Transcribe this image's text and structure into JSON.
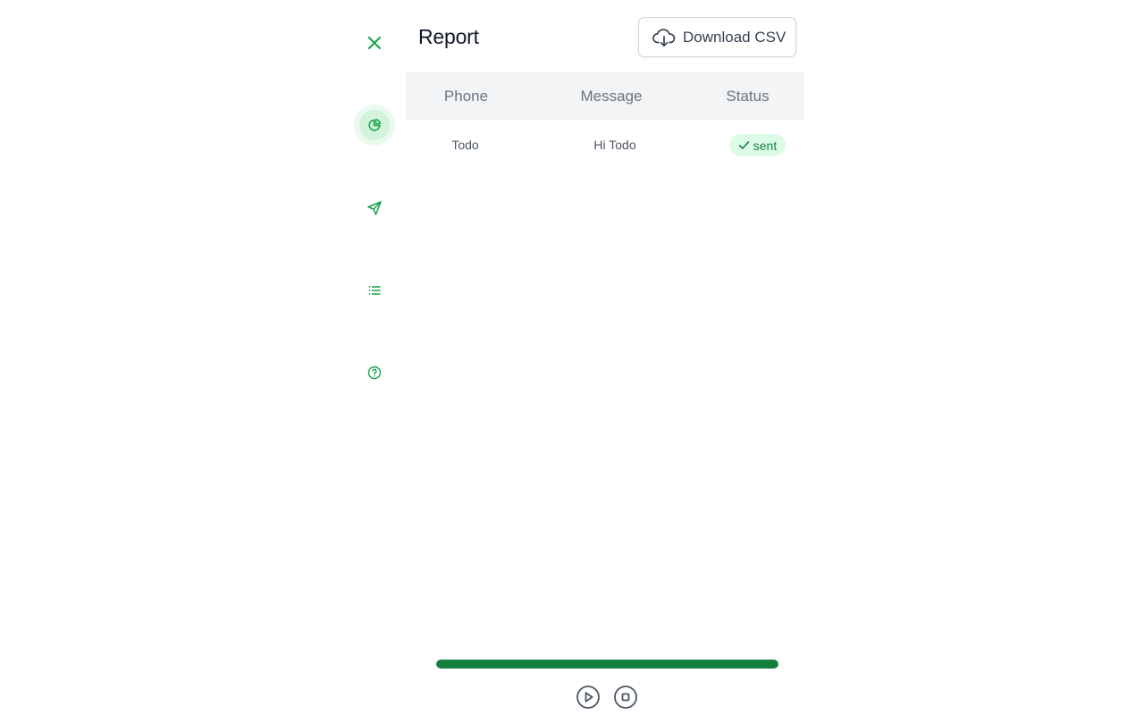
{
  "colors": {
    "accent": "#16a34a",
    "progress": "#15803d",
    "badge_bg": "#dcfce7",
    "badge_text": "#15803d"
  },
  "sidebar": {
    "items": [
      {
        "icon": "close-icon"
      },
      {
        "icon": "pie-chart-icon",
        "active": true
      },
      {
        "icon": "send-icon"
      },
      {
        "icon": "list-icon"
      },
      {
        "icon": "help-circle-icon"
      }
    ]
  },
  "header": {
    "title": "Report",
    "download_label": "Download CSV",
    "download_icon": "cloud-download-icon"
  },
  "table": {
    "columns": [
      "Phone",
      "Message",
      "Status"
    ],
    "rows": [
      {
        "phone": "Todo",
        "message": "Hi Todo",
        "status": "sent",
        "status_icon": "check-icon"
      }
    ]
  },
  "progress": {
    "value_percent": 100
  },
  "controls": {
    "play_icon": "play-circle-icon",
    "stop_icon": "stop-circle-icon"
  }
}
